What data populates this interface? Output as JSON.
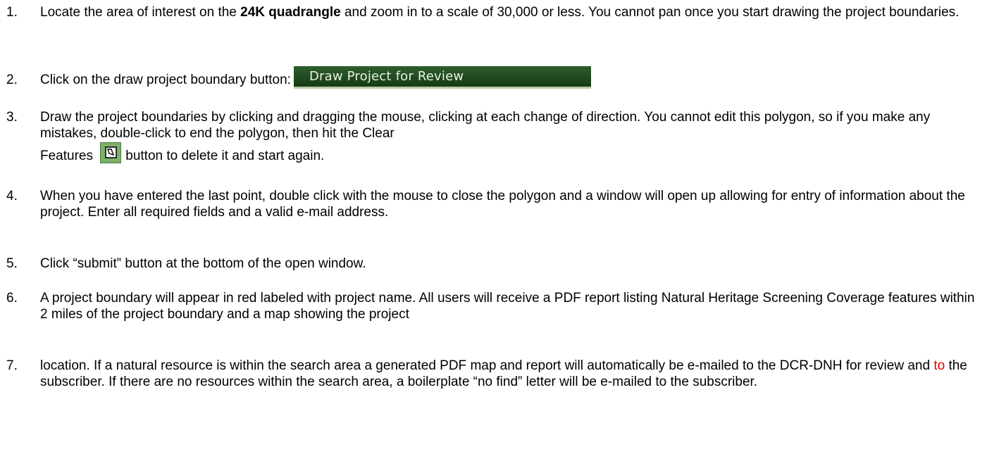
{
  "steps": [
    {
      "number": "1.",
      "pre": "Locate the area of interest on the ",
      "bold": "24K quadrangle",
      "post": " and zoom in to a scale of 30,000 or less.  You cannot pan once you start drawing the project boundaries."
    },
    {
      "number": "2.",
      "text": "Click on the draw project boundary button:",
      "button_label": "Draw Project for Review"
    },
    {
      "number": "3.",
      "text_a": "Draw the project boundaries by clicking and dragging the mouse, clicking at each change of direction. You cannot edit this polygon, so if you make any mistakes, double-click to end the polygon, then hit the Clear",
      "text_b_pre": "Features",
      "clear_icon": "clear-features-icon",
      "text_b_post": "button to delete it and start again."
    },
    {
      "number": "4.",
      "text": "When you have entered the last point, double click with the mouse to close the polygon and a window will open up allowing for entry of information about the project. Enter all required fields and a valid e-mail address."
    },
    {
      "number": "5.",
      "text": "Click “submit” button at the bottom of the open window."
    },
    {
      "number": "6.",
      "text": "A project boundary will appear in red labeled with project name. All users will receive a PDF report listing Natural Heritage Screening Coverage features within 2 miles of the project boundary and a map showing the project"
    },
    {
      "number": "7.",
      "pre": "location.  If a natural resource is within the search area a generated PDF map and report will automatically be e-mailed to the DCR-DNH for review and ",
      "red": "to",
      "post": " the subscriber. If there are no resources within the search area, a boilerplate “no find” letter will be e-mailed to the subscriber."
    }
  ],
  "colors": {
    "text": "#000000",
    "highlight_red": "#e00000",
    "button_bg": "#214a21",
    "button_text": "#e9f2dc",
    "clear_button_bg": "#7db06a"
  }
}
